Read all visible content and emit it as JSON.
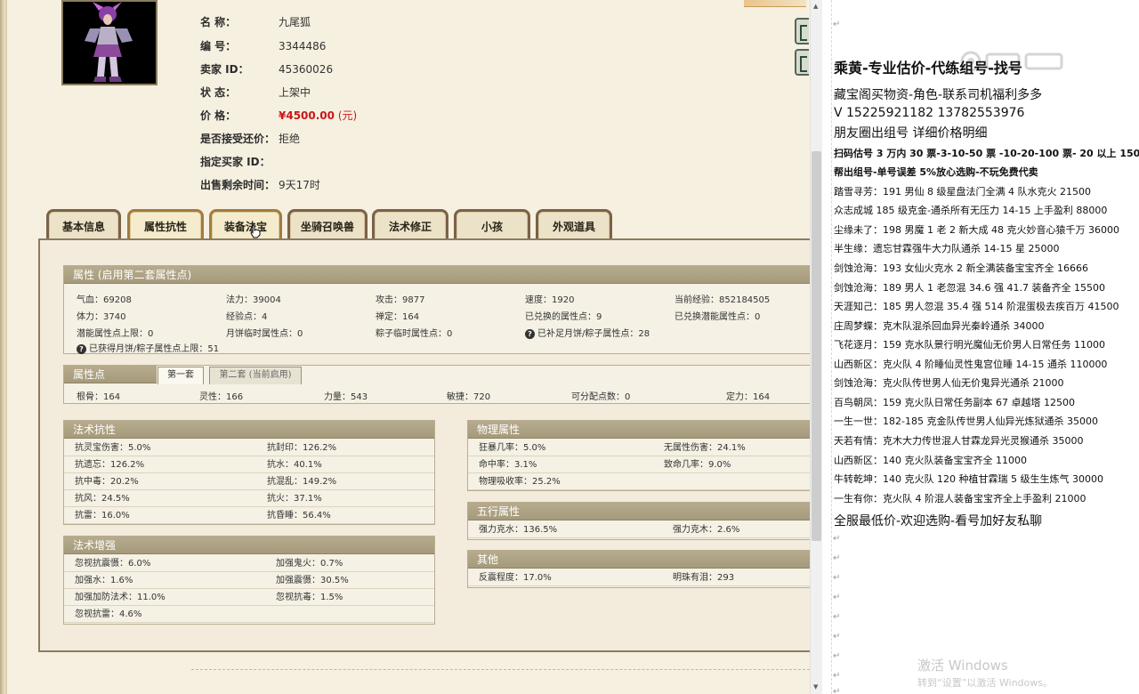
{
  "info": {
    "name_label": "名 称：",
    "name_value": "九尾狐",
    "id_label": "编 号：",
    "id_value": "3344486",
    "seller_label": "卖家 ID：",
    "seller_value": "45360026",
    "status_label": "状 态：",
    "status_value": "上架中",
    "price_label": "价 格：",
    "price_value": "¥4500.00",
    "price_unit": "(元)",
    "bargain_label": "是否接受还价：",
    "bargain_value": "拒绝",
    "buyer_label": "指定买家 ID：",
    "buyer_value": "",
    "time_label": "出售剩余时间：",
    "time_value": "9天17时"
  },
  "tabs": [
    "基本信息",
    "属性抗性",
    "装备法宝",
    "坐骑召唤兽",
    "法术修正",
    "小孩",
    "外观道具"
  ],
  "attr": {
    "title": "属性 (启用第二套属性点)",
    "rows": [
      [
        "气血：69208",
        "法力：39004",
        "攻击：9877",
        "速度：1920",
        "当前经验：852184505"
      ],
      [
        "体力：3740",
        "经验点：4",
        "禅定：164",
        "已兑换的属性点：9",
        "已兑换潜能属性点：0"
      ],
      [
        "潜能属性点上限：0",
        "月饼临时属性点：0",
        "粽子临时属性点：0",
        "已补足月饼/粽子属性点：28",
        ""
      ]
    ],
    "note": "已获得月饼/粽子属性点上限：51"
  },
  "points": {
    "title": "属性点",
    "subtab1": "第一套",
    "subtab2": "第二套 (当前启用)",
    "cells": [
      "根骨：164",
      "灵性：166",
      "力量：543",
      "敏捷：720",
      "可分配点数：0",
      "定力：164"
    ]
  },
  "resist": {
    "title": "法术抗性",
    "cells": [
      [
        "抗灵宝伤害：5.0%",
        "抗封印：126.2%"
      ],
      [
        "抗遗忘：126.2%",
        "抗水：40.1%"
      ],
      [
        "抗中毒：20.2%",
        "抗混乱：149.2%"
      ],
      [
        "抗风：24.5%",
        "抗火：37.1%"
      ],
      [
        "抗雷：16.0%",
        "抗昏睡：56.4%"
      ]
    ]
  },
  "enhance": {
    "title": "法术增强",
    "cells": [
      [
        "忽视抗震慑：6.0%",
        "加强鬼火：0.7%"
      ],
      [
        "加强水：1.6%",
        "加强震慑：30.5%"
      ],
      [
        "加强加防法术：11.0%",
        "忽视抗毒：1.5%"
      ],
      [
        "忽视抗雷：4.6%",
        ""
      ]
    ]
  },
  "physical": {
    "title": "物理属性",
    "cells": [
      [
        "狂暴几率：5.0%",
        "无属性伤害：24.1%"
      ],
      [
        "命中率：3.1%",
        "致命几率：9.0%"
      ],
      [
        "物理吸收率：25.2%",
        ""
      ]
    ]
  },
  "wuxing": {
    "title": "五行属性",
    "cells": [
      [
        "强力克水：136.5%",
        "强力克木：2.6%"
      ]
    ]
  },
  "other": {
    "title": "其他",
    "cells": [
      [
        "反震程度：17.0%",
        "明珠有泪：293"
      ]
    ]
  },
  "doc": {
    "title": "乘黄-专业估价-代练组号-找号",
    "lines": [
      {
        "cls": "big",
        "text": "藏宝阁买物资-角色-联系司机福利多多"
      },
      {
        "cls": "big",
        "text": "V 15225921182   13782553976"
      },
      {
        "cls": "big",
        "text": "朋友圈出组号    详细价格明细"
      },
      {
        "cls": "bold",
        "text": "扫码估号 3 万内 30 票-3-10-50 票  -10-20-100 票- 20 以上 150"
      },
      {
        "cls": "bold",
        "text": "帮出组号-单号误差 5%放心选购-不玩免费代卖"
      },
      {
        "cls": "norm",
        "text": "踏雪寻芳：191 男仙 8 级星盘法门全满 4 队水克火 21500"
      },
      {
        "cls": "norm",
        "text": "众志成城  185 级克金-通杀所有无压力 14-15 上手盈利 88000"
      },
      {
        "cls": "norm",
        "text": "尘缘未了：198 男魔 1 老 2 新大成 48 克火妙音心猿千万 36000"
      },
      {
        "cls": "norm",
        "text": "半生缘：遗忘甘霖强牛大力队通杀 14-15 星 25000"
      },
      {
        "cls": "norm",
        "text": "剑蚀沧海：193 女仙火克水 2 新全满装备宝宝齐全 16666"
      },
      {
        "cls": "norm",
        "text": "剑蚀沧海：189 男人 1 老忽混 34.6 强 41.7 装备齐全 15500"
      },
      {
        "cls": "norm",
        "text": "天涯知己：185 男人忽混 35.4 强 514 阶混蛋极去疾百万 41500"
      },
      {
        "cls": "norm",
        "text": "庄周梦蝶：克木队混杀回血异光秦岭通杀 34000"
      },
      {
        "cls": "norm",
        "text": "飞花逐月：159 克水队景行明光魔仙无价男人日常任务 11000"
      },
      {
        "cls": "norm",
        "text": "山西新区：克火队 4 阶睡仙灵性鬼宫位睡 14-15 通杀 110000"
      },
      {
        "cls": "norm",
        "text": "剑蚀沧海：克火队传世男人仙无价鬼异光通杀 21000"
      },
      {
        "cls": "norm",
        "text": "百鸟朝凤：159 克火队日常任务副本 67 卓越塔 12500"
      },
      {
        "cls": "norm",
        "text": "一生一世：182-185 克金队传世男人仙异光炼狱通杀 35000"
      },
      {
        "cls": "norm",
        "text": "天若有情：克木大力传世混人甘霖龙异光灵猴通杀 35000"
      },
      {
        "cls": "norm",
        "text": "山西新区：140 克火队装备宝宝齐全 11000"
      },
      {
        "cls": "norm",
        "text": "牛转乾坤：140 克火队 120 种植甘霖瑞 5 级生生炼气 30000"
      },
      {
        "cls": "norm",
        "text": "一生有你：克火队 4 阶混人装备宝宝齐全上手盈利 21000"
      },
      {
        "cls": "big",
        "text": "全服最低价-欢迎选购-看号加好友私聊"
      }
    ],
    "watermark_1": "激活 Windows",
    "watermark_2": "转到“设置”以激活 Windows。"
  }
}
